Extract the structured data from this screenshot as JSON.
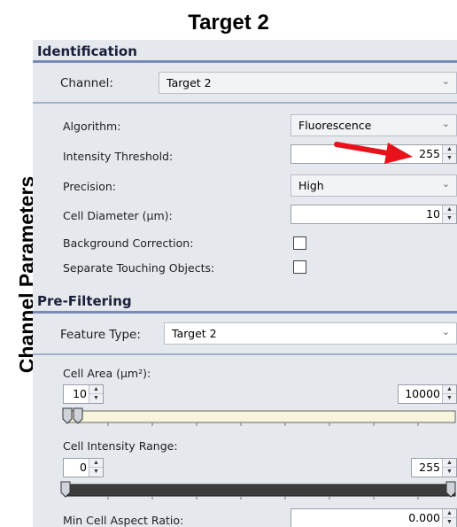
{
  "figure": {
    "title": "Target 2",
    "side_label": "Channel Parameters"
  },
  "identification": {
    "header": "Identification",
    "channel_label": "Channel:",
    "channel_value": "Target 2",
    "algorithm_label": "Algorithm:",
    "algorithm_value": "Fluorescence",
    "intensity_label": "Intensity Threshold:",
    "intensity_value": "255",
    "precision_label": "Precision:",
    "precision_value": "High",
    "diameter_label": "Cell Diameter (µm):",
    "diameter_value": "10",
    "background_label": "Background Correction:",
    "background_checked": false,
    "separate_label": "Separate Touching Objects:",
    "separate_checked": false
  },
  "prefiltering": {
    "header": "Pre-Filtering",
    "feature_label": "Feature Type:",
    "feature_value": "Target 2",
    "area_label": "Cell Area (µm²):",
    "area_min": "10",
    "area_max": "10000",
    "area_range_fraction": [
      0.02,
      1.0
    ],
    "range_label": "Cell Intensity Range:",
    "range_min": "0",
    "range_max": "255",
    "range_fraction": [
      0.0,
      1.0
    ],
    "aspect_label": "Min Cell Aspect Ratio:",
    "aspect_value": "0.000"
  },
  "colors": {
    "arrow": "#e8121b",
    "area_track": "#f7f4dc",
    "range_track": "#3c3c3c",
    "header_rule": "#7b8ab4"
  },
  "icons": [
    "chevron-down-icon",
    "spin-up-icon",
    "spin-down-icon",
    "red-arrow-annotation",
    "slider-thumb-icon"
  ]
}
